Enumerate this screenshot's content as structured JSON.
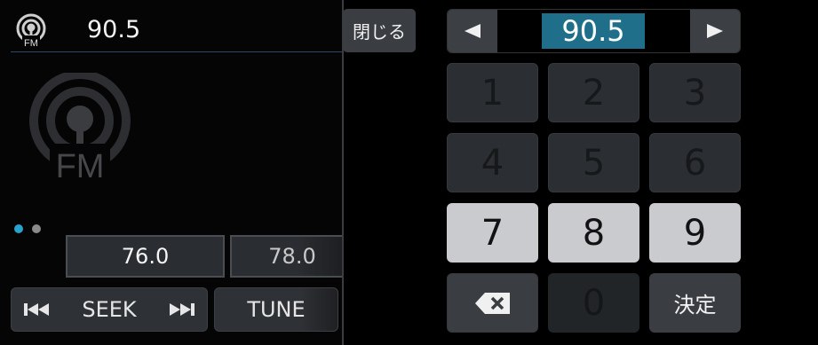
{
  "radio": {
    "band_label": "FM",
    "frequency": "90.5"
  },
  "page_dots": [
    {
      "active": true
    },
    {
      "active": false
    }
  ],
  "presets": [
    "76.0",
    "78.0"
  ],
  "controls": {
    "seek_label": "SEEK",
    "tune_label": "TUNE"
  },
  "keypad": {
    "close_label": "閉じる",
    "entry_value": "90.5",
    "keys": [
      "1",
      "2",
      "3",
      "4",
      "5",
      "6",
      "7",
      "8",
      "9",
      "0"
    ],
    "confirm_label": "決定",
    "enabled_keys": [
      "7",
      "8",
      "9"
    ]
  },
  "colors": {
    "accent": "#2aa3cc",
    "entry_highlight": "#1f6f8b"
  }
}
